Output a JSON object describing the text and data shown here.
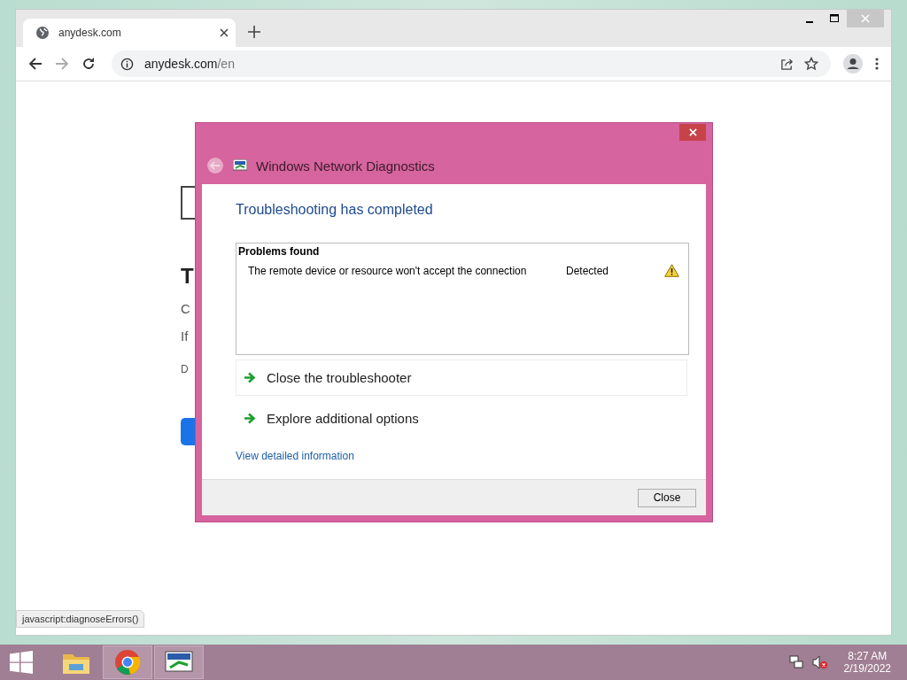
{
  "browser": {
    "tab": {
      "title": "anydesk.com",
      "selected": true
    },
    "address": {
      "host": "anydesk.com",
      "path": "/en"
    },
    "page_fragments": [
      {
        "kind": "logo-box"
      },
      {
        "kind": "heading",
        "text": "T"
      },
      {
        "kind": "para",
        "text": "C"
      },
      {
        "kind": "para",
        "text": "If"
      },
      {
        "kind": "small",
        "text": "D"
      },
      {
        "kind": "button"
      }
    ],
    "status_link": "javascript:diagnoseErrors()"
  },
  "dialog": {
    "title": "Windows Network Diagnostics",
    "heading": "Troubleshooting has completed",
    "problems": {
      "header": "Problems found",
      "rows": [
        {
          "text": "The remote device or resource won't accept the connection",
          "status": "Detected"
        }
      ]
    },
    "options": [
      {
        "label": "Close the troubleshooter",
        "selected": true
      },
      {
        "label": "Explore additional options",
        "selected": false
      }
    ],
    "details_link": "View detailed information",
    "button": "Close"
  },
  "taskbar": {
    "apps": [
      {
        "kind": "folder",
        "selected": false
      },
      {
        "kind": "browser",
        "selected": true
      },
      {
        "kind": "network",
        "selected": true
      }
    ],
    "time": "8:27 AM",
    "date": "2/19/2022"
  }
}
